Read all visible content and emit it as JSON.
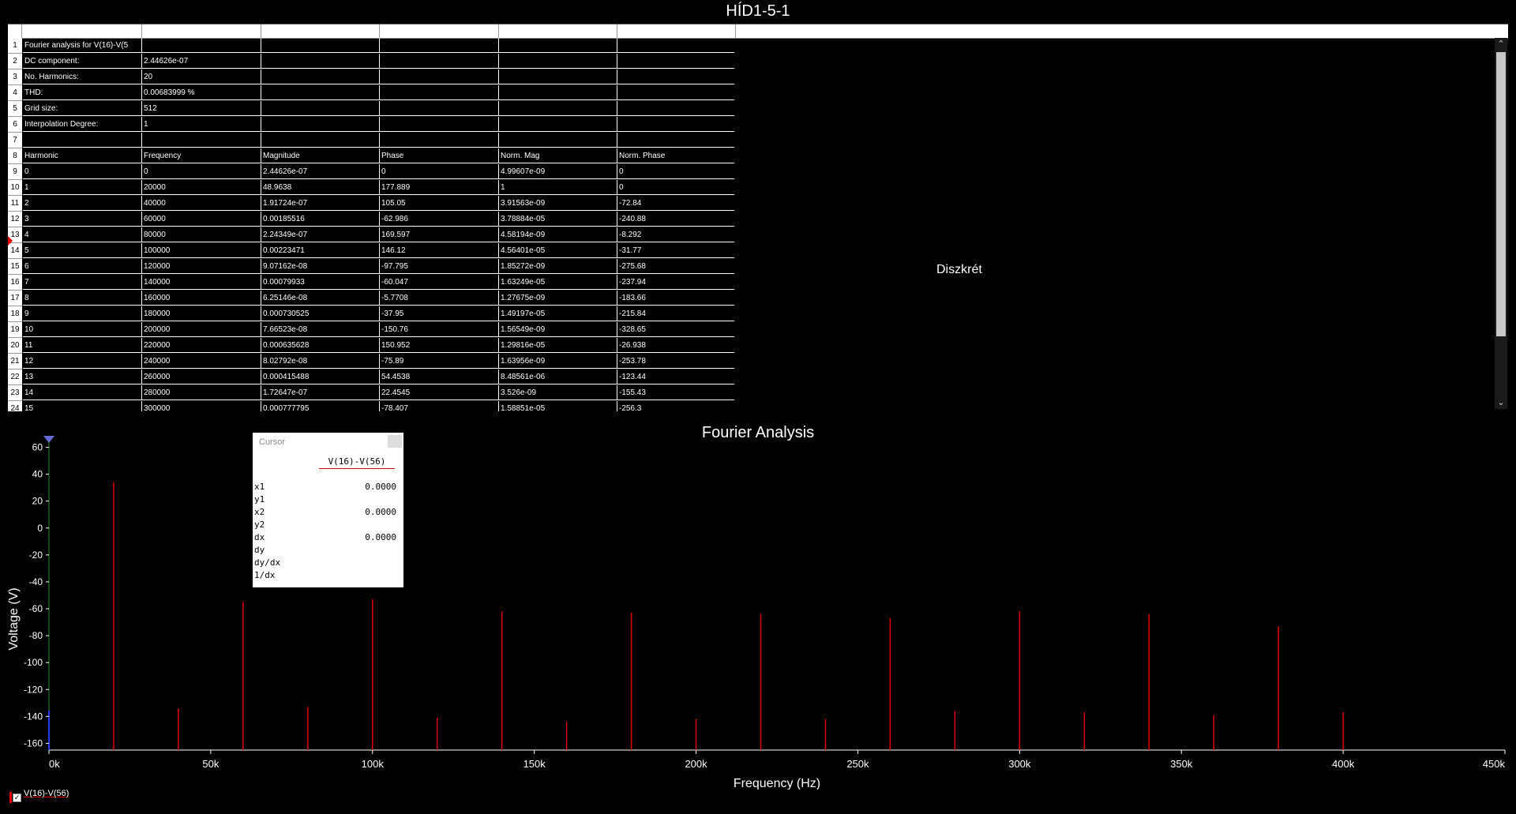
{
  "window": {
    "title": "HÍD1-5-1"
  },
  "table": {
    "placeholder_text": "Diszkrét",
    "rows": [
      {
        "num": "1",
        "cells": [
          "Fourier analysis for V(16)-V(5",
          "",
          "",
          "",
          "",
          ""
        ]
      },
      {
        "num": "2",
        "cells": [
          "DC component:",
          "2.44626e-07",
          "",
          "",
          "",
          ""
        ]
      },
      {
        "num": "3",
        "cells": [
          "No. Harmonics:",
          "20",
          "",
          "",
          "",
          ""
        ]
      },
      {
        "num": "4",
        "cells": [
          "THD:",
          "0.00683999 %",
          "",
          "",
          "",
          ""
        ]
      },
      {
        "num": "5",
        "cells": [
          "Grid size:",
          "512",
          "",
          "",
          "",
          ""
        ]
      },
      {
        "num": "6",
        "cells": [
          "Interpolation Degree:",
          "1",
          "",
          "",
          "",
          ""
        ]
      },
      {
        "num": "7",
        "cells": [
          "",
          "",
          "",
          "",
          "",
          ""
        ]
      },
      {
        "num": "8",
        "cells": [
          "Harmonic",
          "Frequency",
          "Magnitude",
          "Phase",
          "Norm. Mag",
          "Norm. Phase"
        ]
      },
      {
        "num": "9",
        "cells": [
          "0",
          "0",
          "2.44626e-07",
          "0",
          "4.99607e-09",
          "0"
        ]
      },
      {
        "num": "10",
        "cells": [
          "1",
          "20000",
          "48.9638",
          "177.889",
          "1",
          "0"
        ]
      },
      {
        "num": "11",
        "cells": [
          "2",
          "40000",
          "1.91724e-07",
          "105.05",
          "3.91563e-09",
          "-72.84"
        ]
      },
      {
        "num": "12",
        "cells": [
          "3",
          "60000",
          "0.00185516",
          "-62.986",
          "3.78884e-05",
          "-240.88"
        ]
      },
      {
        "num": "13",
        "cells": [
          "4",
          "80000",
          "2.24349e-07",
          "169.597",
          "4.58194e-09",
          "-8.292"
        ]
      },
      {
        "num": "14",
        "cells": [
          "5",
          "100000",
          "0.00223471",
          "146.12",
          "4.56401e-05",
          "-31.77"
        ]
      },
      {
        "num": "15",
        "cells": [
          "6",
          "120000",
          "9.07162e-08",
          "-97.795",
          "1.85272e-09",
          "-275.68"
        ]
      },
      {
        "num": "16",
        "cells": [
          "7",
          "140000",
          "0.00079933",
          "-60.047",
          "1.63249e-05",
          "-237.94"
        ]
      },
      {
        "num": "17",
        "cells": [
          "8",
          "160000",
          "6.25146e-08",
          "-5.7708",
          "1.27675e-09",
          "-183.66"
        ]
      },
      {
        "num": "18",
        "cells": [
          "9",
          "180000",
          "0.000730525",
          "-37.95",
          "1.49197e-05",
          "-215.84"
        ]
      },
      {
        "num": "19",
        "cells": [
          "10",
          "200000",
          "7.66523e-08",
          "-150.76",
          "1.56549e-09",
          "-328.65"
        ]
      },
      {
        "num": "20",
        "cells": [
          "11",
          "220000",
          "0.000635628",
          "150.952",
          "1.29816e-05",
          "-26.938"
        ]
      },
      {
        "num": "21",
        "cells": [
          "12",
          "240000",
          "8.02792e-08",
          "-75.89",
          "1.63956e-09",
          "-253.78"
        ]
      },
      {
        "num": "22",
        "cells": [
          "13",
          "260000",
          "0.000415488",
          "54.4538",
          "8.48561e-06",
          "-123.44"
        ]
      },
      {
        "num": "23",
        "cells": [
          "14",
          "280000",
          "1.72647e-07",
          "22.4545",
          "3.526e-09",
          "-155.43"
        ]
      },
      {
        "num": "24",
        "cells": [
          "15",
          "300000",
          "0.000777795",
          "-78.407",
          "1.58851e-05",
          "-256.3"
        ]
      }
    ]
  },
  "cursor": {
    "title": "Cursor",
    "series": "V(16)-V(56)",
    "rows": [
      {
        "label": "x1",
        "value": "0.0000"
      },
      {
        "label": "y1",
        "value": ""
      },
      {
        "label": "x2",
        "value": "0.0000"
      },
      {
        "label": "y2",
        "value": ""
      },
      {
        "label": "dx",
        "value": "0.0000"
      },
      {
        "label": "dy",
        "value": ""
      },
      {
        "label": "dy/dx",
        "value": ""
      },
      {
        "label": "1/dx",
        "value": ""
      }
    ]
  },
  "legend": {
    "label": "V(16)-V(56)",
    "checked": "✓"
  },
  "colors": {
    "series": "#e00000",
    "axis": "#ffffff",
    "background": "#000000"
  },
  "chart_data": {
    "type": "bar",
    "title": "Fourier Analysis",
    "xlabel": "Frequency (Hz)",
    "ylabel": "Voltage (V)",
    "xlim": [
      0,
      450000
    ],
    "ylim": [
      -165,
      65
    ],
    "xticks": [
      0,
      50000,
      100000,
      150000,
      200000,
      250000,
      300000,
      350000,
      400000,
      450000
    ],
    "xtick_labels": [
      "0k",
      "50k",
      "100k",
      "150k",
      "200k",
      "250k",
      "300k",
      "350k",
      "400k",
      "450k"
    ],
    "yticks": [
      60,
      40,
      20,
      0,
      -20,
      -40,
      -60,
      -80,
      -100,
      -120,
      -140,
      -160
    ],
    "series": [
      {
        "x": [
          20000,
          40000,
          60000,
          80000,
          100000,
          120000,
          140000,
          160000,
          180000,
          200000,
          220000,
          240000,
          260000,
          280000,
          300000,
          320000,
          340000,
          360000,
          380000,
          400000
        ],
        "values": [
          34,
          -134,
          -55,
          -133,
          -53,
          -141,
          -62,
          -144,
          -63,
          -142,
          -64,
          -142,
          -67,
          -136,
          -62,
          -137,
          -64,
          -139,
          -73,
          -137
        ]
      }
    ],
    "grid": false,
    "legend": "bottom-left"
  }
}
